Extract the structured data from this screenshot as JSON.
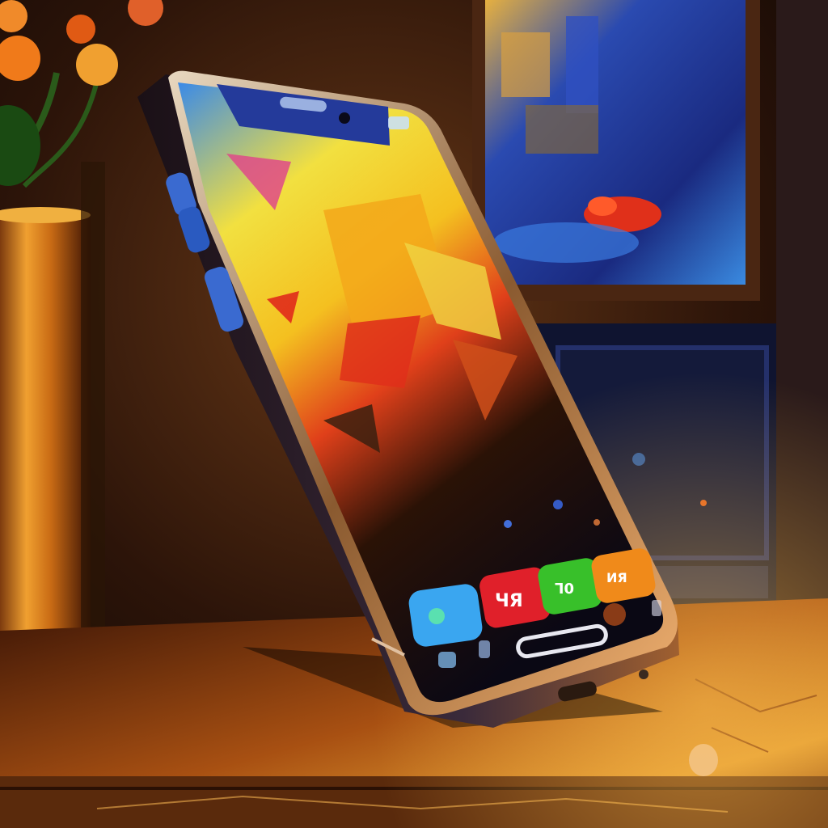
{
  "scene": {
    "subject": "smartphone-painting",
    "colors": {
      "wall_shadow": "#1a0d06",
      "wall_warm": "#5a2e12",
      "table_gold": "#c9761e",
      "table_dark": "#4a1e08",
      "vase_gold": "#d48a2a",
      "frame_brown": "#4a2612",
      "painting_blue": "#1c3a9a",
      "painting_flowers": "#e0301a",
      "door_navy": "#141a3a",
      "phone_bezel": "#c9a27a",
      "phone_button_blue": "#3a6ad0",
      "screen_yellow": "#f4d21e",
      "screen_red": "#e0281a",
      "screen_blue": "#2a6ae8",
      "app_blue": "#3aa6f0",
      "app_red": "#e0202a",
      "app_green": "#38c02a",
      "app_orange": "#f08a1a"
    }
  },
  "dock": {
    "apps": [
      {
        "name": "blue-app",
        "glyph": ""
      },
      {
        "name": "red-app",
        "glyph": "ЧЯ"
      },
      {
        "name": "green-app",
        "glyph": "Ꞁ0"
      },
      {
        "name": "orange-app",
        "glyph": "ИЯ"
      }
    ]
  }
}
